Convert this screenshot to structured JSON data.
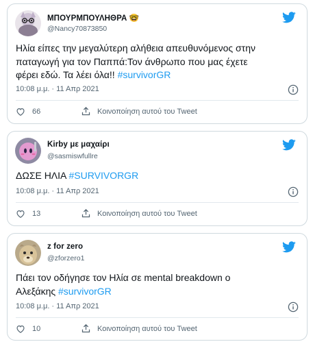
{
  "tweets": [
    {
      "display_name": "ΜΠΟΥΡΜΠΟΥΛΗΘΡΑ",
      "emoji": "🤓",
      "handle": "@Nancy70873850",
      "text_lines": [
        "Ηλία είπες την μεγαλύτερη αλήθεια απευθυνόμενος στην",
        "παταγωγή για τον Παππά:Τον άνθρωπο που μας έχετε",
        "φέρει εδώ. Τα λέει όλα!! "
      ],
      "hashtag": "#survivorGR",
      "timestamp": "10:08 μ.μ. · 11 Απρ 2021",
      "likes": "66",
      "share_label": "Κοινοποίηση αυτού του Tweet"
    },
    {
      "display_name": "Kirby με μαχαίρι",
      "handle": "@sasmiswfullre",
      "text_lines": [
        "ΔΩΣΕ ΗΛΙΑ "
      ],
      "hashtag": "#SURVIVORGR",
      "timestamp": "10:08 μ.μ. · 11 Απρ 2021",
      "likes": "13",
      "share_label": "Κοινοποίηση αυτού του Tweet"
    },
    {
      "display_name": "z for zero",
      "handle": "@zforzero1",
      "text_lines": [
        "Πάει τον οδήγησε τον Ηλία σε mental breakdown ο",
        "Αλεξάκης "
      ],
      "hashtag": "#survivorGR",
      "timestamp": "10:08 μ.μ. · 11 Απρ 2021",
      "likes": "10",
      "share_label": "Κοινοποίηση αυτού του Tweet"
    }
  ],
  "colors": {
    "brand": "#1d9bf0",
    "text": "#0f1419",
    "muted": "#536471",
    "border": "#cfd9de"
  },
  "icons": {
    "brand": "twitter-bird-icon",
    "info": "info-icon",
    "like": "heart-icon",
    "share": "share-icon"
  }
}
